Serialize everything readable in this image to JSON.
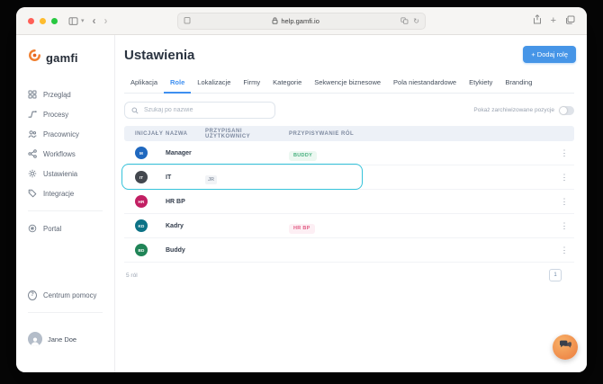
{
  "browser": {
    "url": "help.gamfi.io",
    "new_tab_label": "+"
  },
  "sidebar": {
    "logo": "gamfi",
    "nav": [
      {
        "label": "Przegląd"
      },
      {
        "label": "Procesy"
      },
      {
        "label": "Pracownicy"
      },
      {
        "label": "Workflows"
      },
      {
        "label": "Ustawienia"
      },
      {
        "label": "Integracje"
      }
    ],
    "portal_label": "Portal",
    "help_label": "Centrum pomocy",
    "user_name": "Jane Doe"
  },
  "main": {
    "title": "Ustawienia",
    "add_role_button": "+ Dodaj rolę",
    "tabs": [
      "Aplikacja",
      "Role",
      "Lokalizacje",
      "Firmy",
      "Kategorie",
      "Sekwencje biznesowe",
      "Pola niestandardowe",
      "Etykiety",
      "Branding"
    ],
    "active_tab": "Role",
    "search_placeholder": "Szukaj po nazwie",
    "archived_toggle_label": "Pokaż zarchiwizowane pozycje",
    "archived_toggle_on": false,
    "table": {
      "columns": [
        "Inicjały",
        "Nazwa",
        "Przypisani użytkownicy",
        "Przypisywanie ról"
      ],
      "rows": [
        {
          "initials": "M",
          "name": "Manager",
          "assigned_users": "",
          "role_badge": "Buddy",
          "avatar_color": "#1f68bf",
          "highlighted": false
        },
        {
          "initials": "IT",
          "name": "IT",
          "assigned_users": "JR",
          "role_badge": "",
          "avatar_color": "#43474e",
          "highlighted": true
        },
        {
          "initials": "HR",
          "name": "HR BP",
          "assigned_users": "",
          "role_badge": "",
          "avatar_color": "#c21f63",
          "highlighted": false
        },
        {
          "initials": "KD",
          "name": "Kadry",
          "assigned_users": "",
          "role_badge": "HR BP",
          "avatar_color": "#0c7286",
          "highlighted": false
        },
        {
          "initials": "BD",
          "name": "Buddy",
          "assigned_users": "",
          "role_badge": "",
          "avatar_color": "#208457",
          "highlighted": false
        }
      ],
      "footer_count": "5 ról",
      "current_page": "1"
    }
  },
  "colors": {
    "accent_blue": "#4695e7",
    "active_tab_blue": "#3e8ff0",
    "highlight_ring": "#35c3da",
    "badge_green_text": "#47b07e",
    "badge_green_bg": "#ecf8f1",
    "badge_pink_text": "#e25c84",
    "badge_pink_bg": "#fdeff4",
    "logo_orange": "#f07f2f",
    "chat_orange": "#ef8b4a",
    "traffic_red": "#ff5f57",
    "traffic_yellow": "#febc2e",
    "traffic_green": "#28c840"
  }
}
